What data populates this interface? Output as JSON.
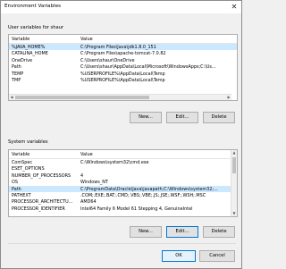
{
  "window": {
    "title": "Environment Variables",
    "close_glyph": "✕"
  },
  "user_section": {
    "label": "User variables for shaur",
    "columns": [
      "Variable",
      "Value"
    ],
    "rows": [
      {
        "variable": "%JAVA_HOME%",
        "value": "C:\\Program Files\\Java\\jdk1.8.0_151",
        "selected": true
      },
      {
        "variable": "CATALINA_HOME",
        "value": "C:\\Program Files\\apache-tomcat-7.0.82",
        "selected": false
      },
      {
        "variable": "OneDrive",
        "value": "C:\\Users\\shaur\\OneDrive",
        "selected": false
      },
      {
        "variable": "Path",
        "value": "C:\\Users\\shaur\\AppData\\Local\\Microsoft\\WindowsApps;C:\\Us...",
        "selected": false
      },
      {
        "variable": "TEMP",
        "value": "%USERPROFILE%\\AppData\\Local\\Temp",
        "selected": false
      },
      {
        "variable": "TMP",
        "value": "%USERPROFILE%\\AppData\\Local\\Temp",
        "selected": false
      }
    ],
    "buttons": {
      "new": "New...",
      "edit": "Edit...",
      "delete": "Delete"
    }
  },
  "system_section": {
    "label": "System variables",
    "columns": [
      "Variable",
      "Value"
    ],
    "rows": [
      {
        "variable": "ComSpec",
        "value": "C:\\Windows\\system32\\cmd.exe",
        "selected": false
      },
      {
        "variable": "ESET_OPTIONS",
        "value": "",
        "selected": false
      },
      {
        "variable": "NUMBER_OF_PROCESSORS",
        "value": "4",
        "selected": false
      },
      {
        "variable": "OS",
        "value": "Windows_NT",
        "selected": false
      },
      {
        "variable": "Path",
        "value": "C:\\ProgramData\\Oracle\\Java\\javapath;C:\\Windows\\system32;...",
        "selected": true
      },
      {
        "variable": "PATHEXT",
        "value": ".COM;.EXE;.BAT;.CMD;.VBS;.VBE;.JS;.JSE;.WSF;.WSH;.MSC",
        "selected": false
      },
      {
        "variable": "PROCESSOR_ARCHITECTU...",
        "value": "AMD64",
        "selected": false
      },
      {
        "variable": "PROCESSOR_IDENTIFIER",
        "value": "Intel64 Family 6 Model 61 Stepping 4, GenuineIntel",
        "selected": false
      }
    ],
    "buttons": {
      "new": "New...",
      "edit": "Edit...",
      "delete": "Delete"
    }
  },
  "dialog_buttons": {
    "ok": "OK",
    "cancel": "Cancel"
  },
  "colors": {
    "selection": "#cce8ff",
    "focus_border": "#0078d7"
  }
}
